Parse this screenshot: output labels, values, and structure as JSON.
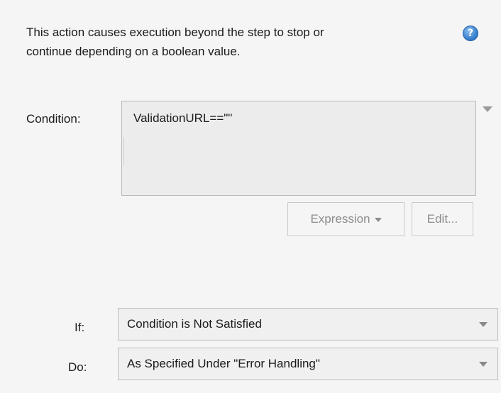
{
  "description": {
    "line1": "This action causes execution beyond the step to stop or",
    "line2": "continue depending on a boolean value."
  },
  "help": {
    "icon": "help-icon",
    "glyph": "?"
  },
  "condition": {
    "label": "Condition:",
    "value": "ValidationURL==\"\""
  },
  "buttons": {
    "expression_label": "Expression",
    "edit_label": "Edit..."
  },
  "if_field": {
    "label": "If:",
    "selected": "Condition is Not Satisfied"
  },
  "do_field": {
    "label": "Do:",
    "selected": "As Specified Under \"Error Handling\""
  },
  "colors": {
    "background": "#f5f5f5",
    "help_icon": "#3b82d0",
    "disabled_text": "#8c8c8c"
  }
}
